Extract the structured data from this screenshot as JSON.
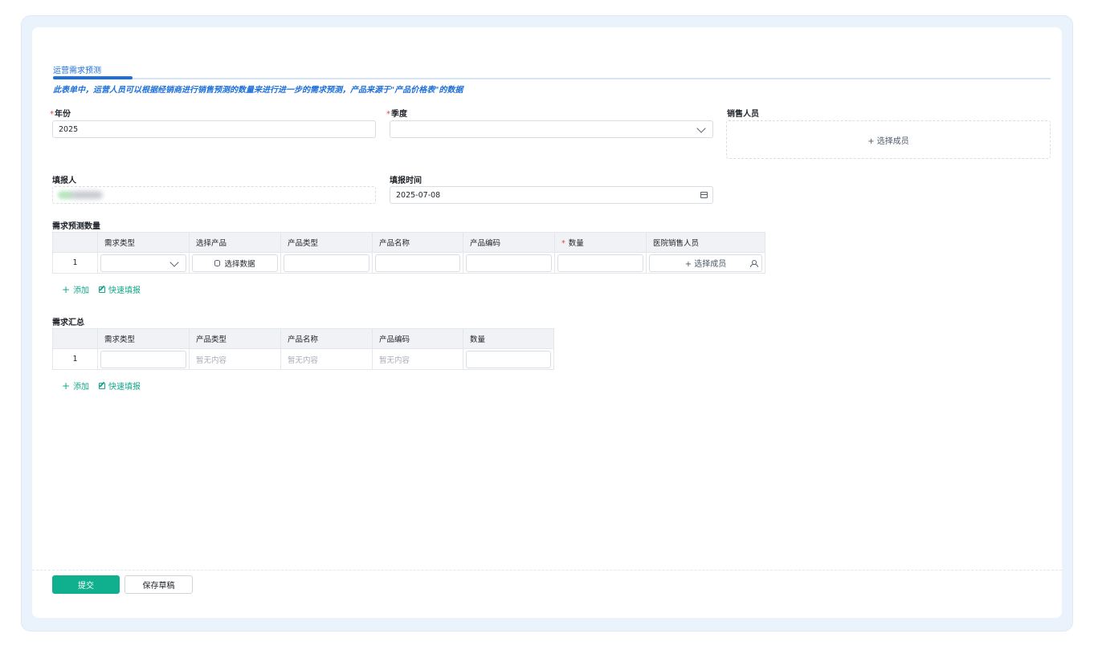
{
  "form": {
    "tab_title": "运营需求预测",
    "hint": "此表单中，运营人员可以根据经销商进行销售预测的数量来进行进一步的需求预测，产品来源于\"产品价格表\"的数据"
  },
  "fields": {
    "year": {
      "required_mark": "*",
      "label": "年份",
      "value": "2025"
    },
    "quarter": {
      "required_mark": "*",
      "label": "季度",
      "value": ""
    },
    "sales_person": {
      "label": "销售人员",
      "button": "+ 选择成员"
    },
    "filler": {
      "label": "填报人"
    },
    "fill_time": {
      "label": "填报时间",
      "value": "2025-07-08"
    }
  },
  "forecast_table": {
    "title": "需求预测数量",
    "columns": [
      "需求类型",
      "选择产品",
      "产品类型",
      "产品名称",
      "产品编码",
      "数量",
      "医院销售人员"
    ],
    "quantity_required_mark": "*",
    "row": {
      "index": "1",
      "select_data": "选择数据",
      "select_member": "+ 选择成员"
    }
  },
  "summary_table": {
    "title": "需求汇总",
    "columns": [
      "需求类型",
      "产品类型",
      "产品名称",
      "产品编码",
      "数量"
    ],
    "row": {
      "index": "1",
      "empty_type": "暂无内容",
      "empty_name": "暂无内容",
      "empty_code": "暂无内容"
    }
  },
  "actions": {
    "add": "添加",
    "quick_fill": "快速填报"
  },
  "footer": {
    "submit": "提交",
    "save_draft": "保存草稿"
  },
  "colors": {
    "accent_blue": "#1d6fd9",
    "primary_green": "#10b08e",
    "required_red": "#e54545"
  },
  "icons": [
    "plus-icon",
    "edit-icon",
    "chevron-down-icon",
    "calendar-icon",
    "database-icon",
    "user-icon"
  ]
}
